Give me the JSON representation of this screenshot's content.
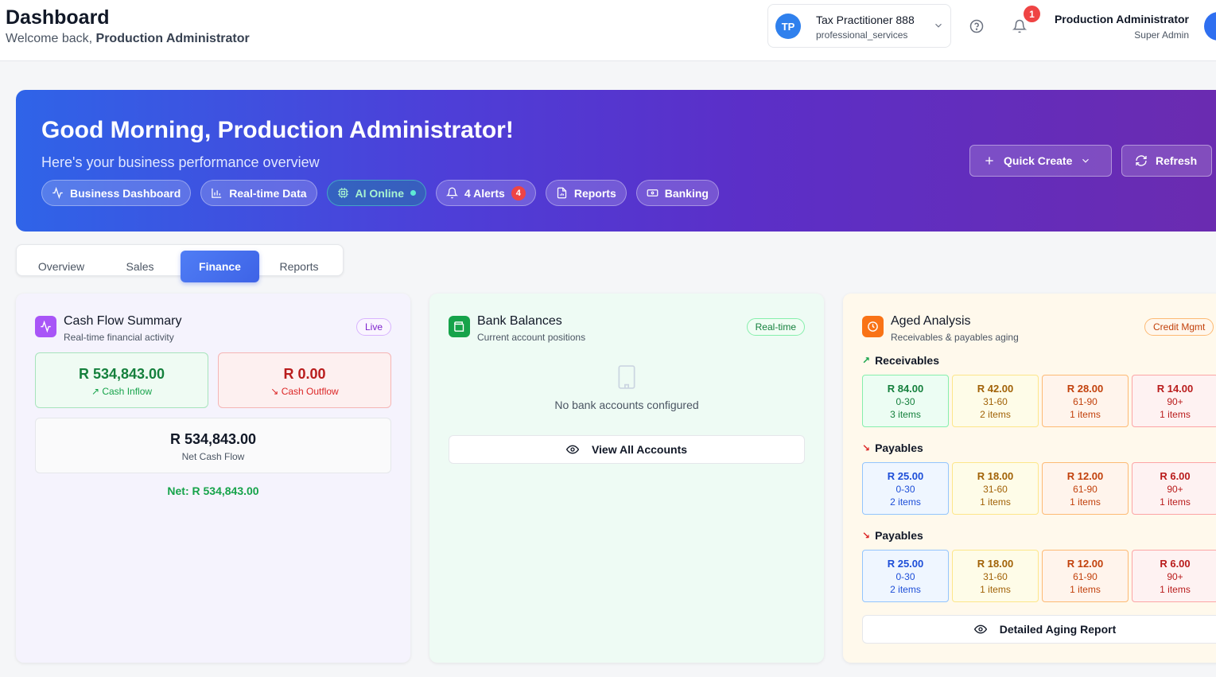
{
  "header": {
    "title": "Dashboard",
    "welcome_prefix": "Welcome back,",
    "welcome_name": "Production Administrator",
    "org": {
      "initials": "TP",
      "name": "Tax Practitioner 888",
      "type": "professional_services"
    },
    "notifications_count": "1",
    "user": {
      "name": "Production Administrator",
      "role": "Super Admin"
    }
  },
  "hero": {
    "title": "Good Morning, Production Administrator!",
    "subtitle": "Here's your business performance overview",
    "chips": {
      "business": "Business Dashboard",
      "realtime": "Real-time Data",
      "ai": "AI Online",
      "alerts": "4 Alerts",
      "alerts_count": "4",
      "reports": "Reports",
      "banking": "Banking"
    },
    "quick_create": "Quick Create",
    "refresh": "Refresh"
  },
  "tabs": [
    "Overview",
    "Sales",
    "Finance",
    "Reports"
  ],
  "active_tab": "Finance",
  "cash_flow": {
    "title": "Cash Flow Summary",
    "subtitle": "Real-time financial activity",
    "badge": "Live",
    "inflow_value": "R 534,843.00",
    "inflow_label": "Cash Inflow",
    "outflow_value": "R 0.00",
    "outflow_label": "Cash Outflow",
    "net_value": "R 534,843.00",
    "net_label": "Net Cash Flow",
    "net_footer": "Net: R 534,843.00"
  },
  "bank": {
    "title": "Bank Balances",
    "subtitle": "Current account positions",
    "badge": "Real-time",
    "empty": "No bank accounts configured",
    "view_all": "View All Accounts"
  },
  "aged": {
    "title": "Aged Analysis",
    "subtitle": "Receivables & payables aging",
    "badge": "Credit Mgmt",
    "receivables_label": "Receivables",
    "receivables": [
      {
        "amount": "R 84.00",
        "range": "0-30",
        "items": "3 items"
      },
      {
        "amount": "R 42.00",
        "range": "31-60",
        "items": "2 items"
      },
      {
        "amount": "R 28.00",
        "range": "61-90",
        "items": "1 items"
      },
      {
        "amount": "R 14.00",
        "range": "90+",
        "items": "1 items"
      }
    ],
    "payables_label": "Payables",
    "payables": [
      {
        "amount": "R 25.00",
        "range": "0-30",
        "items": "2 items"
      },
      {
        "amount": "R 18.00",
        "range": "31-60",
        "items": "1 items"
      },
      {
        "amount": "R 12.00",
        "range": "61-90",
        "items": "1 items"
      },
      {
        "amount": "R 6.00",
        "range": "90+",
        "items": "1 items"
      }
    ],
    "detailed_report": "Detailed Aging Report"
  },
  "colors": {
    "accent": "#3e63e6",
    "inflow": "#15803d",
    "outflow": "#b91c1c",
    "hero_start": "#2f64e8",
    "hero_end": "#6b2bb0"
  }
}
